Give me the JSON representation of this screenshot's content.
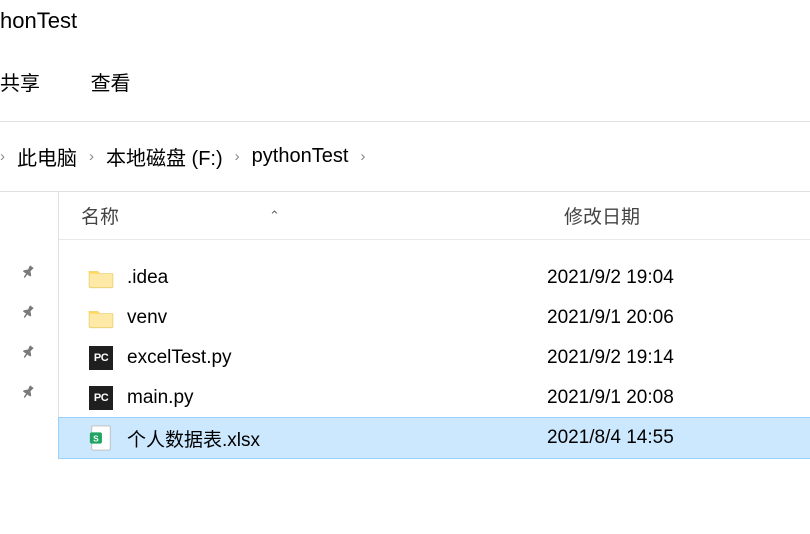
{
  "window": {
    "title_fragment": "honTest"
  },
  "tabs": {
    "share": "共享",
    "view": "查看"
  },
  "breadcrumb": {
    "items": [
      "此电脑",
      "本地磁盘 (F:)",
      "pythonTest"
    ]
  },
  "columns": {
    "name": "名称",
    "modified": "修改日期"
  },
  "files": [
    {
      "name": ".idea",
      "type": "folder",
      "modified": "2021/9/2 19:04",
      "selected": false
    },
    {
      "name": "venv",
      "type": "folder",
      "modified": "2021/9/1 20:06",
      "selected": false
    },
    {
      "name": "excelTest.py",
      "type": "py",
      "modified": "2021/9/2 19:14",
      "selected": false
    },
    {
      "name": "main.py",
      "type": "py",
      "modified": "2021/9/1 20:08",
      "selected": false
    },
    {
      "name": "个人数据表.xlsx",
      "type": "xlsx",
      "modified": "2021/8/4 14:55",
      "selected": true
    }
  ],
  "icons": {
    "pc_badge": "PC"
  }
}
